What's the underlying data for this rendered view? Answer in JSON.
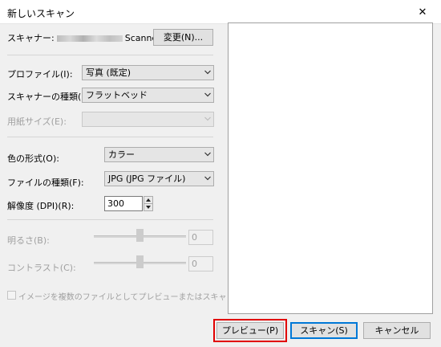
{
  "window": {
    "title": "新しいスキャン",
    "close_glyph": "✕"
  },
  "scanner": {
    "label": "スキャナー:",
    "name_suffix": "Scanner",
    "change_button": "変更(N)..."
  },
  "profile": {
    "label": "プロファイル(I):",
    "value": "写真 (既定)"
  },
  "source": {
    "label": "スキャナーの種類(U):",
    "value": "フラットベッド"
  },
  "paper_size": {
    "label": "用紙サイズ(E):",
    "value": ""
  },
  "color_format": {
    "label": "色の形式(O):",
    "value": "カラー"
  },
  "file_type": {
    "label": "ファイルの種類(F):",
    "value": "JPG (JPG ファイル)"
  },
  "resolution": {
    "label": "解像度 (DPI)(R):",
    "value": "300"
  },
  "brightness": {
    "label": "明るさ(B):",
    "value": "0",
    "level": 0.5
  },
  "contrast": {
    "label": "コントラスト(C):",
    "value": "0",
    "level": 0.5
  },
  "preview_checkbox": {
    "label": "イメージを複数のファイルとしてプレビューまたはスキャンする(T)",
    "checked": false
  },
  "buttons": {
    "preview": "プレビュー(P)",
    "scan": "スキャン(S)",
    "cancel": "キャンセル"
  },
  "colors": {
    "highlight": "#e10000",
    "default_button_border": "#0078d7"
  }
}
